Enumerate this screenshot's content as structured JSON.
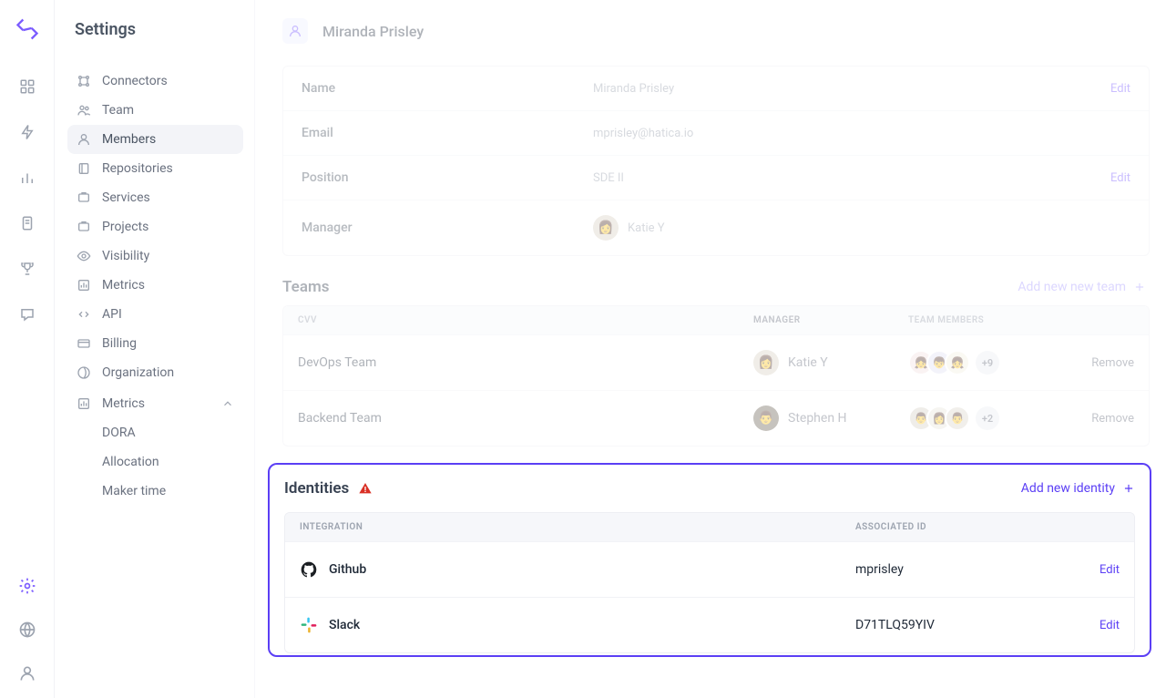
{
  "sidebar": {
    "title": "Settings",
    "items": [
      {
        "label": "Connectors"
      },
      {
        "label": "Team"
      },
      {
        "label": "Members"
      },
      {
        "label": "Repositories"
      },
      {
        "label": "Services"
      },
      {
        "label": "Projects"
      },
      {
        "label": "Visibility"
      },
      {
        "label": "Metrics"
      },
      {
        "label": "API"
      },
      {
        "label": "Billing"
      },
      {
        "label": "Organization"
      }
    ],
    "metrics_group": {
      "label": "Metrics",
      "children": [
        {
          "label": "DORA"
        },
        {
          "label": "Allocation"
        },
        {
          "label": "Maker time"
        }
      ]
    }
  },
  "profile": {
    "name": "Miranda Prisley",
    "fields": {
      "name_label": "Name",
      "name_value": "Miranda Prisley",
      "email_label": "Email",
      "email_value": "mprisley@hatica.io",
      "position_label": "Position",
      "position_value": "SDE II",
      "manager_label": "Manager",
      "manager_value": "Katie Y"
    },
    "edit_label": "Edit"
  },
  "teams": {
    "title": "Teams",
    "add_label": "Add new new team",
    "headers": {
      "cvv": "CVV",
      "manager": "MANAGER",
      "members": "TEAM MEMBERS"
    },
    "rows": [
      {
        "name": "DevOps Team",
        "manager": "Katie Y",
        "more": "+9",
        "remove": "Remove"
      },
      {
        "name": "Backend Team",
        "manager": "Stephen H",
        "more": "+2",
        "remove": "Remove"
      }
    ]
  },
  "identities": {
    "title": "Identities",
    "add_label": "Add new identity",
    "headers": {
      "integration": "INTEGRATION",
      "assoc": "ASSOCIATED ID"
    },
    "rows": [
      {
        "integration": "Github",
        "assoc": "mprisley",
        "edit": "Edit"
      },
      {
        "integration": "Slack",
        "assoc": "D71TLQ59YIV",
        "edit": "Edit"
      }
    ]
  }
}
